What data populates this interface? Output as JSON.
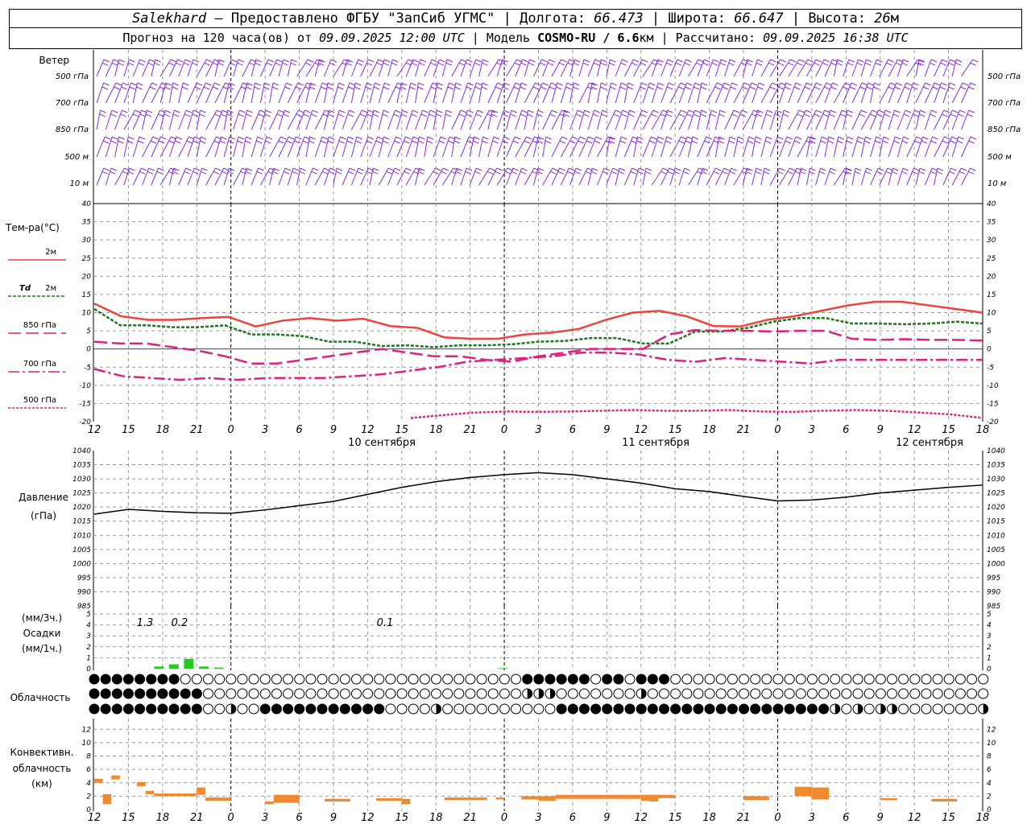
{
  "header": {
    "station": "Salekhard",
    "provided": " – Предоставлено ФГБУ \"ЗапСиб УГМС\" | Долгота: ",
    "lon": "66.473",
    "lat_label": " | Широта: ",
    "lat": "66.647",
    "alt_label": " | Высота: ",
    "alt": "26",
    "alt_unit": "м",
    "forecast_label": "Прогноз на 120 часа(ов) от ",
    "forecast_from": "09.09.2025 12:00 UTC",
    "model_label": " | Модель ",
    "model": "COSMO-RU / 6.6",
    "model_unit": "км",
    "calc_label": " | Рассчитано: ",
    "calc_time": "09.09.2025 16:38 UTC"
  },
  "colors": {
    "wind": "#8a2be2",
    "t2m": "#f0443a",
    "td2m": "#1a7a1a",
    "t850": "#e0207a",
    "t700": "#e0207a",
    "t500": "#e0207a",
    "pressure": "#000000",
    "precip": "#22cc22",
    "conv": "#f08a30",
    "grid": "#999999"
  },
  "wind_panel": {
    "title": "Ветер",
    "levels": [
      "500 гПа",
      "700 гПа",
      "850 гПа",
      "500 м",
      "10 м"
    ]
  },
  "temp_panel": {
    "title": "Тем-ра(°C)",
    "legend": [
      {
        "label": "2м",
        "key": "t2m"
      },
      {
        "label_td": "Td",
        "label": "2м",
        "key": "td2m"
      },
      {
        "label": "850 гПа",
        "key": "t850"
      },
      {
        "label": "700 гПа",
        "key": "t700"
      },
      {
        "label": "500 гПа",
        "key": "t500"
      }
    ]
  },
  "pressure_panel": {
    "title": "Давление",
    "unit": "(гПа)"
  },
  "precip_panel": {
    "unit3": "(мм/3ч.)",
    "title": "Осадки",
    "unit1": "(мм/1ч.)",
    "amounts": [
      "1.3",
      "0.2",
      "0.1"
    ]
  },
  "cloud_panel": {
    "title": "Облачность"
  },
  "conv_panel": {
    "title1": "Конвективн.",
    "title2": "облачность",
    "unit": "(км)"
  },
  "time_axis": {
    "hour_labels": [
      "12",
      "15",
      "18",
      "21",
      "0",
      "3",
      "6",
      "9",
      "12",
      "15",
      "18",
      "21",
      "0",
      "3",
      "6",
      "9",
      "12",
      "15",
      "18",
      "21",
      "0",
      "3",
      "6",
      "9",
      "12",
      "15",
      "18"
    ],
    "dates": [
      "10 сентября",
      "11 сентября",
      "12 сентября"
    ]
  },
  "chart_data": [
    {
      "type": "line",
      "title": "Тем-ра(°C)",
      "ylim": [
        -20,
        40
      ],
      "yticks": [
        -20,
        -15,
        -10,
        -5,
        0,
        5,
        10,
        15,
        20,
        25,
        30,
        35,
        40
      ],
      "x_hours": [
        0,
        3,
        6,
        9,
        12,
        15,
        18,
        21,
        24,
        27,
        30,
        33,
        36,
        39,
        42,
        45,
        48,
        51,
        54,
        57,
        60,
        63,
        66,
        69,
        72,
        75,
        78
      ],
      "series": [
        {
          "name": "2м",
          "key": "t2m",
          "values": [
            12.5,
            9,
            8,
            8,
            8.5,
            8.8,
            6.2,
            7.8,
            8.5,
            7.8,
            8.3,
            6.3,
            5.8,
            3.2,
            2.8,
            2.8,
            4,
            4.5,
            5.5,
            8,
            10,
            10.5,
            9,
            6.3,
            6.2,
            8,
            9,
            10.5,
            12,
            13,
            13,
            12,
            11,
            10
          ]
        },
        {
          "name": "Td 2м",
          "key": "td2m",
          "values": [
            11,
            6.5,
            6.5,
            6,
            6,
            6.5,
            4,
            4,
            3.5,
            2,
            2,
            0.8,
            1,
            0.5,
            1,
            1,
            1.3,
            2,
            2.2,
            3,
            3,
            1.5,
            1.5,
            4.8,
            4.8,
            5.8,
            7.5,
            8.5,
            8.5,
            7,
            7,
            6.8,
            7,
            7.5,
            7
          ]
        },
        {
          "name": "850 гПа",
          "key": "t850",
          "values": [
            2,
            1.5,
            1.5,
            0.5,
            -0.5,
            -2,
            -4,
            -4,
            -3,
            -2,
            -1,
            0,
            -1,
            -2,
            -2,
            -3,
            -3.5,
            -2,
            -1,
            0,
            0,
            0,
            4,
            5.2,
            5,
            5,
            4.8,
            5,
            5,
            2.8,
            2.5,
            2.7,
            2.5,
            2.5,
            2.3
          ]
        },
        {
          "name": "700 гПа",
          "key": "t700",
          "values": [
            -5.5,
            -7.5,
            -8,
            -8.5,
            -8,
            -8.5,
            -8,
            -8,
            -8,
            -7.5,
            -7,
            -6,
            -5,
            -3.5,
            -3,
            -2.5,
            -2,
            -1,
            -1,
            -1.5,
            -3,
            -3.5,
            -2.5,
            -3,
            -3.5,
            -4,
            -3,
            -3,
            -3,
            -3,
            -3,
            -3
          ]
        },
        {
          "name": "500 гПа",
          "key": "t500",
          "values": [
            -19,
            -18.2,
            -17.5,
            -17.2,
            -17.3,
            -17.2,
            -17,
            -16.8,
            -17,
            -17,
            -16.8,
            -17.2,
            -17.3,
            -17,
            -16.8,
            -17,
            -17.5,
            -18,
            -19
          ]
        }
      ]
    },
    {
      "type": "line",
      "title": "Давление",
      "ylabel": "(гПа)",
      "ylim": [
        985,
        1040
      ],
      "yticks": [
        985,
        990,
        995,
        1000,
        1005,
        1010,
        1015,
        1020,
        1025,
        1030,
        1035,
        1040
      ],
      "series": [
        {
          "name": "Давление",
          "values": [
            1017.5,
            1019.2,
            1018.5,
            1018,
            1017.8,
            1019,
            1020.5,
            1022,
            1024.5,
            1027,
            1029,
            1030.5,
            1031.5,
            1032.2,
            1031.5,
            1030,
            1028.5,
            1026.5,
            1025.5,
            1023.8,
            1022.2,
            1022.5,
            1023.5,
            1025,
            1026,
            1027,
            1027.8
          ]
        }
      ]
    },
    {
      "type": "bar",
      "title": "Осадки",
      "ylabel": "(мм/1ч.)",
      "ylim": [
        0,
        5
      ],
      "yticks": [
        0,
        1,
        2,
        3,
        4,
        5
      ],
      "series": [
        {
          "name": "Осадки",
          "values": [
            {
              "x": 4,
              "v": 0.2
            },
            {
              "x": 5,
              "v": 0.4
            },
            {
              "x": 6,
              "v": 0.9
            },
            {
              "x": 7,
              "v": 0.2
            },
            {
              "x": 8,
              "v": 0.1
            },
            {
              "x": 27,
              "v": 0.05
            }
          ]
        }
      ],
      "labels": [
        "1.3",
        "0.2",
        "0.1"
      ]
    },
    {
      "type": "bar",
      "title": "Конвективн. облачность",
      "ylabel": "(км)",
      "ylim": [
        0,
        13
      ],
      "yticks": [
        0,
        2,
        4,
        6,
        8,
        10,
        12
      ],
      "bars": [
        {
          "x0": 0,
          "x1": 1,
          "bottom": 4,
          "top": 4.6
        },
        {
          "x0": 1,
          "x1": 2,
          "bottom": 0.8,
          "top": 2.3
        },
        {
          "x0": 2,
          "x1": 3,
          "bottom": 4.5,
          "top": 5.1
        },
        {
          "x0": 5,
          "x1": 6,
          "bottom": 3.5,
          "top": 4.1
        },
        {
          "x0": 6,
          "x1": 7,
          "bottom": 2.3,
          "top": 2.8
        },
        {
          "x0": 7,
          "x1": 12,
          "bottom": 2,
          "top": 2.4
        },
        {
          "x0": 12,
          "x1": 13,
          "bottom": 2.2,
          "top": 3.3
        },
        {
          "x0": 13,
          "x1": 16,
          "bottom": 1.3,
          "top": 1.8
        },
        {
          "x0": 20,
          "x1": 21,
          "bottom": 0.8,
          "top": 1.2
        },
        {
          "x0": 21,
          "x1": 24,
          "bottom": 1,
          "top": 2.2
        },
        {
          "x0": 27,
          "x1": 30,
          "bottom": 1.2,
          "top": 1.6
        },
        {
          "x0": 33,
          "x1": 36,
          "bottom": 1.3,
          "top": 1.7
        },
        {
          "x0": 36,
          "x1": 37,
          "bottom": 0.8,
          "top": 1.6
        },
        {
          "x0": 41,
          "x1": 46,
          "bottom": 1.4,
          "top": 1.8
        },
        {
          "x0": 47,
          "x1": 48,
          "bottom": 1.5,
          "top": 1.8
        },
        {
          "x0": 50,
          "x1": 52,
          "bottom": 1.5,
          "top": 2
        },
        {
          "x0": 52,
          "x1": 54,
          "bottom": 1.3,
          "top": 2
        },
        {
          "x0": 54,
          "x1": 64,
          "bottom": 1.6,
          "top": 2.2
        },
        {
          "x0": 64,
          "x1": 65,
          "bottom": 1.3,
          "top": 2.2
        },
        {
          "x0": 65,
          "x1": 66,
          "bottom": 1.2,
          "top": 2.2
        },
        {
          "x0": 65.5,
          "x1": 68,
          "bottom": 1.7,
          "top": 2.2
        },
        {
          "x0": 76,
          "x1": 79,
          "bottom": 1.4,
          "top": 2
        },
        {
          "x0": 82,
          "x1": 84,
          "bottom": 2,
          "top": 3.4
        },
        {
          "x0": 84,
          "x1": 86,
          "bottom": 1.5,
          "top": 3.3
        },
        {
          "x0": 92,
          "x1": 94,
          "bottom": 1.4,
          "top": 1.7
        },
        {
          "x0": 98,
          "x1": 101,
          "bottom": 1.2,
          "top": 1.6
        }
      ]
    }
  ]
}
